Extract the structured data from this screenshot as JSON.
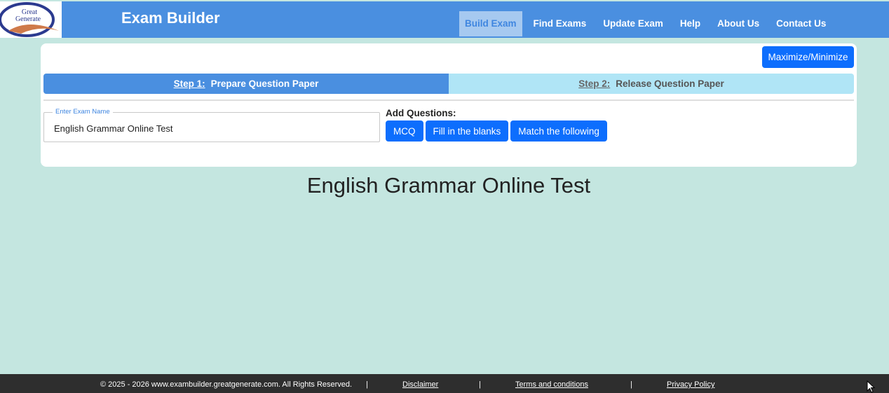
{
  "header": {
    "logo_line1": "Great",
    "logo_line2": "Generate",
    "title": "Exam Builder",
    "nav": [
      "Build Exam",
      "Find Exams",
      "Update Exam",
      "Help",
      "About Us",
      "Contact Us"
    ]
  },
  "card": {
    "maximize_label": "Maximize/Minimize",
    "step1": {
      "num": "Step 1:",
      "label": "Prepare Question Paper"
    },
    "step2": {
      "num": "Step 2:",
      "label": "Release Question Paper"
    },
    "exam_name_legend": "Enter Exam Name",
    "exam_name_value": "English Grammar Online Test",
    "add_questions_label": "Add Questions:",
    "question_types": [
      "MCQ",
      "Fill in the blanks",
      "Match the following"
    ]
  },
  "main": {
    "exam_heading": "English Grammar Online Test"
  },
  "footer": {
    "copyright": "© 2025 - 2026 www.exambuilder.greatgenerate.com. All Rights Reserved.",
    "separator": "|",
    "links": [
      "Disclaimer",
      "Terms and conditions",
      "Privacy Policy"
    ]
  },
  "colors": {
    "page_bg": "#c4e6e0",
    "header_bg": "#4a8fe0",
    "primary_button": "#0d6efd",
    "step_active": "#4a8fe0",
    "step_inactive": "#b0e5f6",
    "footer_bg": "#2e2e2e"
  }
}
